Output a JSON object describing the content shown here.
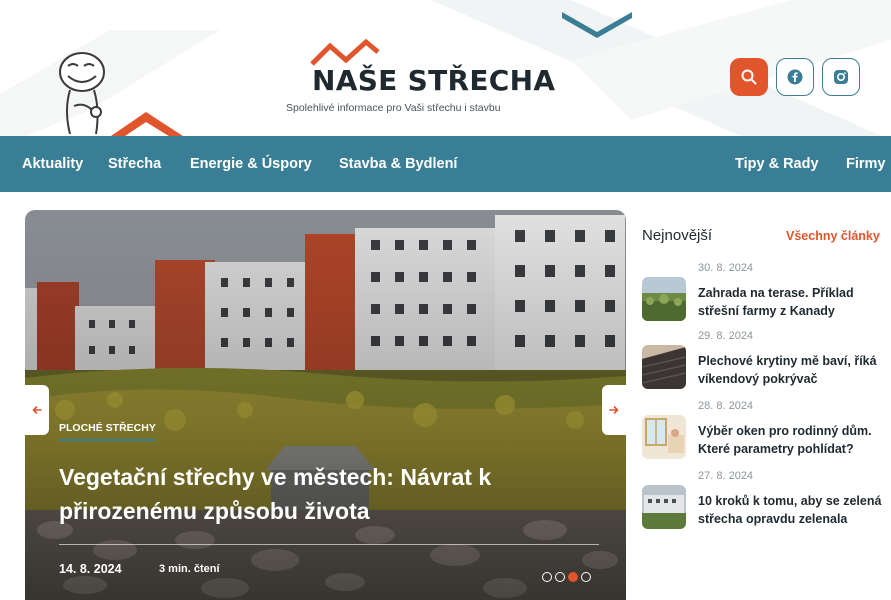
{
  "brand": {
    "name": "NAŠE STŘECHA",
    "tagline": "Spolehlivé informace pro Vaši střechu i stavbu"
  },
  "colors": {
    "accent": "#e0552c",
    "nav": "#3a7e95",
    "text": "#1f2a30"
  },
  "header_icons": [
    "search-icon",
    "facebook-icon",
    "instagram-icon"
  ],
  "nav": {
    "items": [
      {
        "label": "Aktuality"
      },
      {
        "label": "Střecha"
      },
      {
        "label": "Energie & Úspory"
      },
      {
        "label": "Stavba & Bydlení"
      },
      {
        "label": "Tipy & Rady"
      },
      {
        "label": "Firmy"
      }
    ]
  },
  "hero": {
    "category": "PLOCHÉ STŘECHY",
    "title": "Vegetační střechy ve městech: Návrat k přirozenému způsobu života",
    "date": "14. 8. 2024",
    "read_time": "3 min. čtení",
    "slides": 4,
    "active_slide": 3
  },
  "sidebar": {
    "heading": "Nejnovější",
    "all_link": "Všechny články",
    "items": [
      {
        "date": "30. 8. 2024",
        "title": "Zahrada na terase. Příklad střešní farmy z Kanady"
      },
      {
        "date": "29. 8. 2024",
        "title": "Plechové krytiny mě baví, říká víkendový pokrývač"
      },
      {
        "date": "28. 8. 2024",
        "title": "Výběr oken pro rodinný dům. Které parametry pohlídat?"
      },
      {
        "date": "27. 8. 2024",
        "title": "10 kroků k tomu, aby se zelená střecha opravdu zelenala"
      }
    ]
  }
}
